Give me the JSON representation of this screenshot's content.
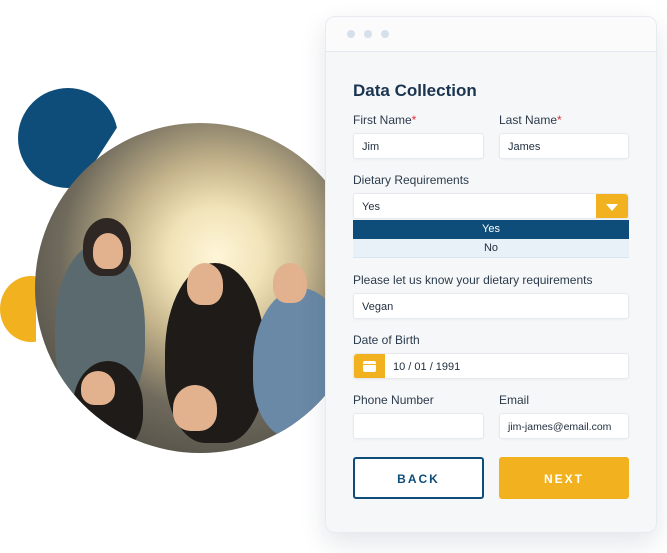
{
  "form": {
    "title": "Data Collection",
    "first_name": {
      "label": "First Name",
      "required_marker": "*",
      "value": "Jim"
    },
    "last_name": {
      "label": "Last Name",
      "required_marker": "*",
      "value": "James"
    },
    "dietary": {
      "label": "Dietary Requirements",
      "selected": "Yes",
      "options": [
        "Yes",
        "No"
      ]
    },
    "dietary_details": {
      "label": "Please let us know your dietary requirements",
      "value": "Vegan"
    },
    "dob": {
      "label": "Date of Birth",
      "value": "10 / 01 / 1991"
    },
    "phone": {
      "label": "Phone Number",
      "value": ""
    },
    "email": {
      "label": "Email",
      "value": "jim-james@email.com"
    },
    "back_label": "BACK",
    "next_label": "NEXT"
  },
  "icons": {
    "window_dots": "three-dot-window-controls",
    "dropdown": "caret-down-icon",
    "calendar": "calendar-icon"
  },
  "colors": {
    "navy": "#0e4d7a",
    "yellow": "#f2b21f",
    "required": "#e0303b",
    "card_bg": "#f6f7f9"
  }
}
